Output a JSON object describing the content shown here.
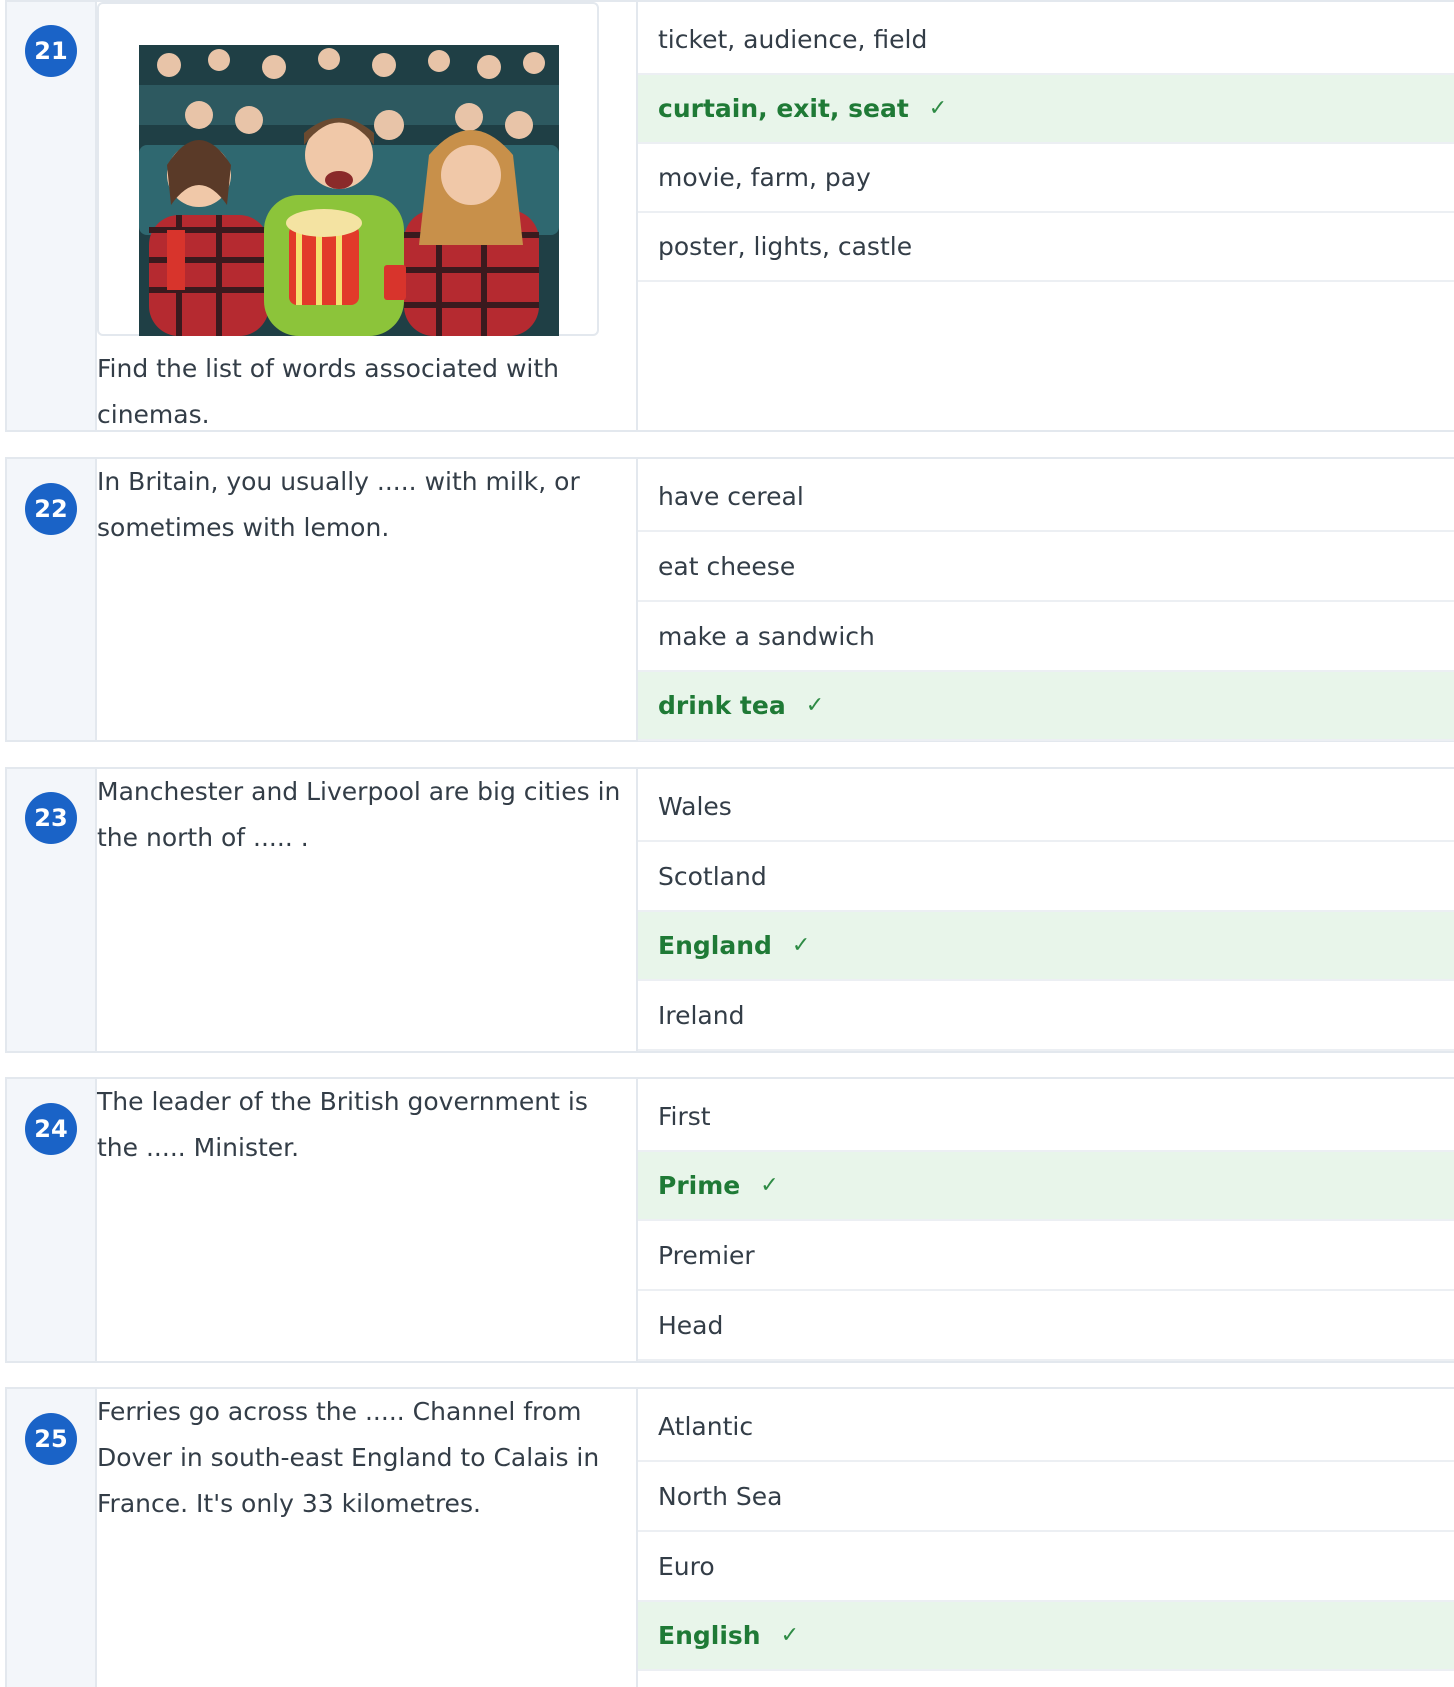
{
  "questions": [
    {
      "number": "21",
      "prompt": "Find the list of words associated with cinemas.",
      "image_alt": "photo-cinema-audience",
      "answers": [
        {
          "text": "ticket, audience, field",
          "correct": false
        },
        {
          "text": "curtain, exit, seat",
          "correct": true
        },
        {
          "text": "movie, farm, pay",
          "correct": false
        },
        {
          "text": "poster, lights, castle",
          "correct": false
        }
      ]
    },
    {
      "number": "22",
      "prompt": "In Britain, you usually ..... with milk, or sometimes with lemon.",
      "answers": [
        {
          "text": "have cereal",
          "correct": false
        },
        {
          "text": "eat cheese",
          "correct": false
        },
        {
          "text": "make a sandwich",
          "correct": false
        },
        {
          "text": "drink tea",
          "correct": true
        }
      ]
    },
    {
      "number": "23",
      "prompt": "Manchester and Liverpool are big cities in the north of ..... .",
      "answers": [
        {
          "text": "Wales",
          "correct": false
        },
        {
          "text": "Scotland",
          "correct": false
        },
        {
          "text": "England",
          "correct": true
        },
        {
          "text": "Ireland",
          "correct": false
        }
      ]
    },
    {
      "number": "24",
      "prompt": "The leader of the British government is the ..... Minister.",
      "answers": [
        {
          "text": "First",
          "correct": false
        },
        {
          "text": "Prime",
          "correct": true
        },
        {
          "text": "Premier",
          "correct": false
        },
        {
          "text": "Head",
          "correct": false
        }
      ]
    },
    {
      "number": "25",
      "prompt": "Ferries go across the ..... Channel from Dover in south-east England to Calais in France. It's only 33 kilometres.",
      "answers": [
        {
          "text": "Atlantic",
          "correct": false
        },
        {
          "text": "North Sea",
          "correct": false
        },
        {
          "text": "Euro",
          "correct": false
        },
        {
          "text": "English",
          "correct": true
        }
      ]
    }
  ],
  "check_mark": "✓",
  "colors": {
    "badge": "#1a63c7",
    "correct_bg": "#e8f5ea",
    "correct_text": "#1f7a36",
    "number_col_bg": "#f3f6fa"
  }
}
